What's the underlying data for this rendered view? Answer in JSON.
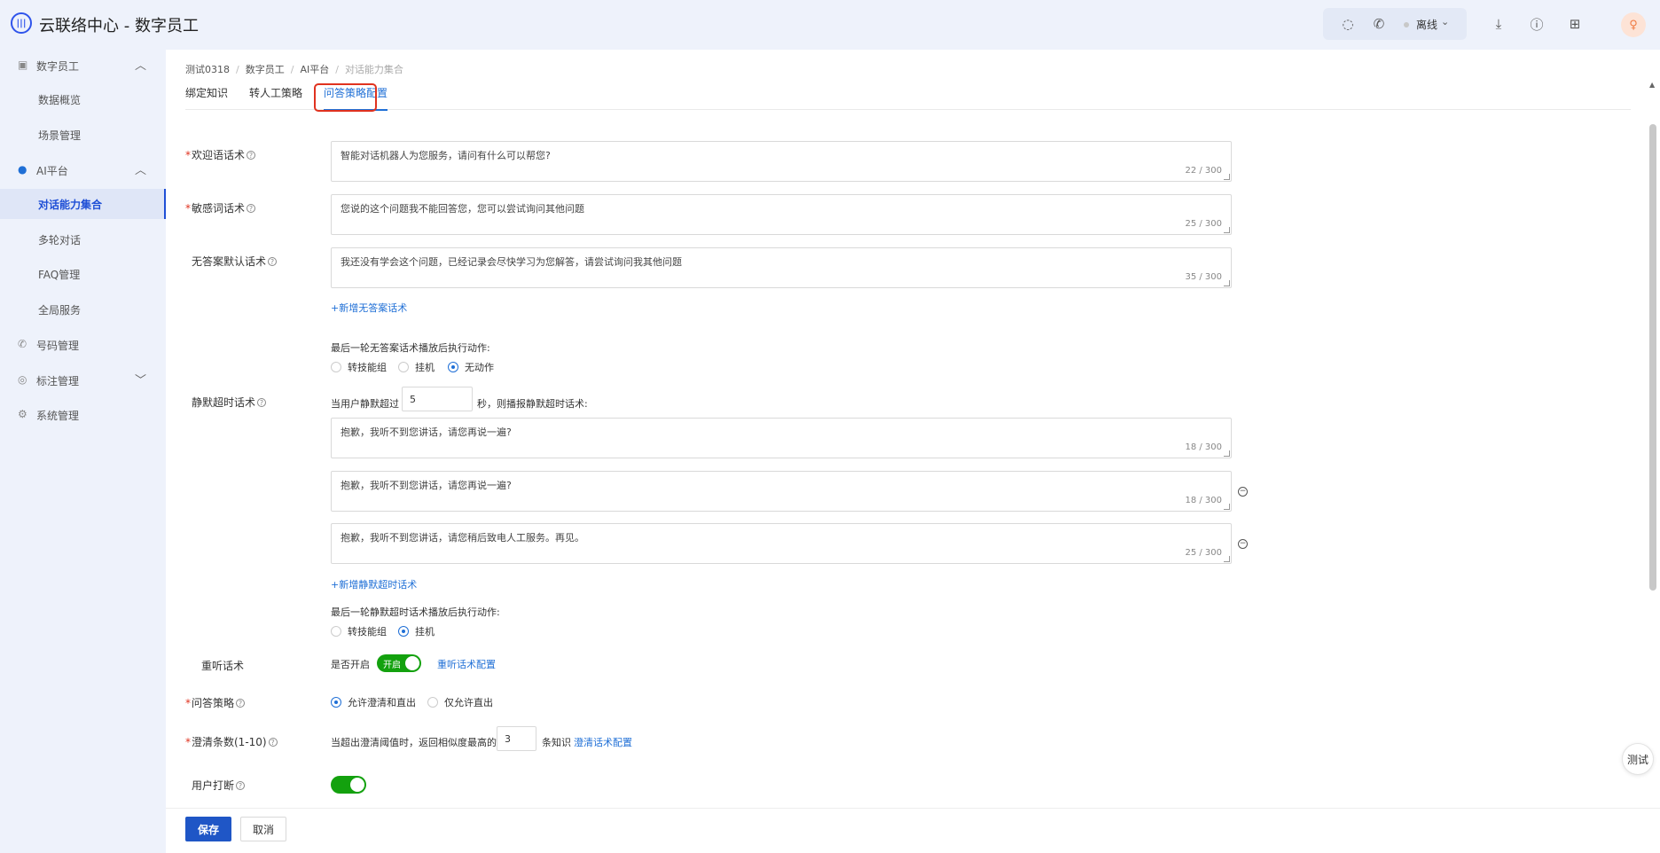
{
  "app": {
    "title": "云联络中心 - 数字员工",
    "logo_icon": "audio-wave-icon"
  },
  "topbar": {
    "status": "离线",
    "avatar_initial": "♀"
  },
  "sidebar": {
    "groups": [
      {
        "label": "数字员工",
        "icon": "robot-icon"
      },
      {
        "label": "AI平台",
        "icon": "ai-dot-icon"
      },
      {
        "label": "号码管理",
        "icon": "phone-icon"
      },
      {
        "label": "标注管理",
        "icon": "tag-icon"
      },
      {
        "label": "系统管理",
        "icon": "gear-icon"
      }
    ],
    "items": [
      {
        "label": "数据概览"
      },
      {
        "label": "场景管理"
      },
      {
        "label": "对话能力集合"
      },
      {
        "label": "多轮对话"
      },
      {
        "label": "FAQ管理"
      },
      {
        "label": "全局服务"
      }
    ]
  },
  "breadcrumb": [
    "测试0318",
    "数字员工",
    "AI平台",
    "对话能力集合"
  ],
  "tabs": [
    {
      "label": "绑定知识"
    },
    {
      "label": "转人工策略"
    },
    {
      "label": "问答策略配置"
    }
  ],
  "form": {
    "welcome": {
      "label": "欢迎语话术",
      "value": "智能对话机器人为您服务，请问有什么可以帮您?",
      "count": "22 / 300"
    },
    "sensitive": {
      "label": "敏感词话术",
      "value": "您说的这个问题我不能回答您，您可以尝试询问其他问题",
      "count": "25 / 300"
    },
    "noanswer": {
      "label": "无答案默认话术",
      "value": "我还没有学会这个问题，已经记录会尽快学习为您解答，请尝试询问我其他问题",
      "count": "35 / 300",
      "add_link": "+新增无答案话术",
      "action_title": "最后一轮无答案话术播放后执行动作:",
      "options": [
        "转技能组",
        "挂机",
        "无动作"
      ]
    },
    "silence": {
      "label": "静默超时话术",
      "prefix": "当用户静默超过",
      "seconds": "5",
      "suffix": "秒，则播报静默超时话术:",
      "items": [
        {
          "value": "抱歉，我听不到您讲话，请您再说一遍?",
          "count": "18 / 300"
        },
        {
          "value": "抱歉，我听不到您讲话，请您再说一遍?",
          "count": "18 / 300"
        },
        {
          "value": "抱歉，我听不到您讲话，请您稍后致电人工服务。再见。",
          "count": "25 / 300"
        }
      ],
      "add_link": "+新增静默超时话术",
      "action_title": "最后一轮静默超时话术播放后执行动作:",
      "options": [
        "转技能组",
        "挂机"
      ]
    },
    "replay": {
      "label": "重听话术",
      "enabled_label": "是否开启",
      "toggle_text": "开启",
      "config_link": "重听话术配置"
    },
    "strategy": {
      "label": "问答策略",
      "options": [
        "允许澄清和直出",
        "仅允许直出"
      ]
    },
    "clarify": {
      "label": "澄清条数(1-10)",
      "prefix": "当超出澄清阈值时，返回相似度最高的",
      "value": "3",
      "suffix": "条知识",
      "config_link": "澄清话术配置"
    },
    "interrupt": {
      "label": "用户打断"
    }
  },
  "footer": {
    "save": "保存",
    "cancel": "取消"
  },
  "floating": {
    "test": "测试"
  }
}
